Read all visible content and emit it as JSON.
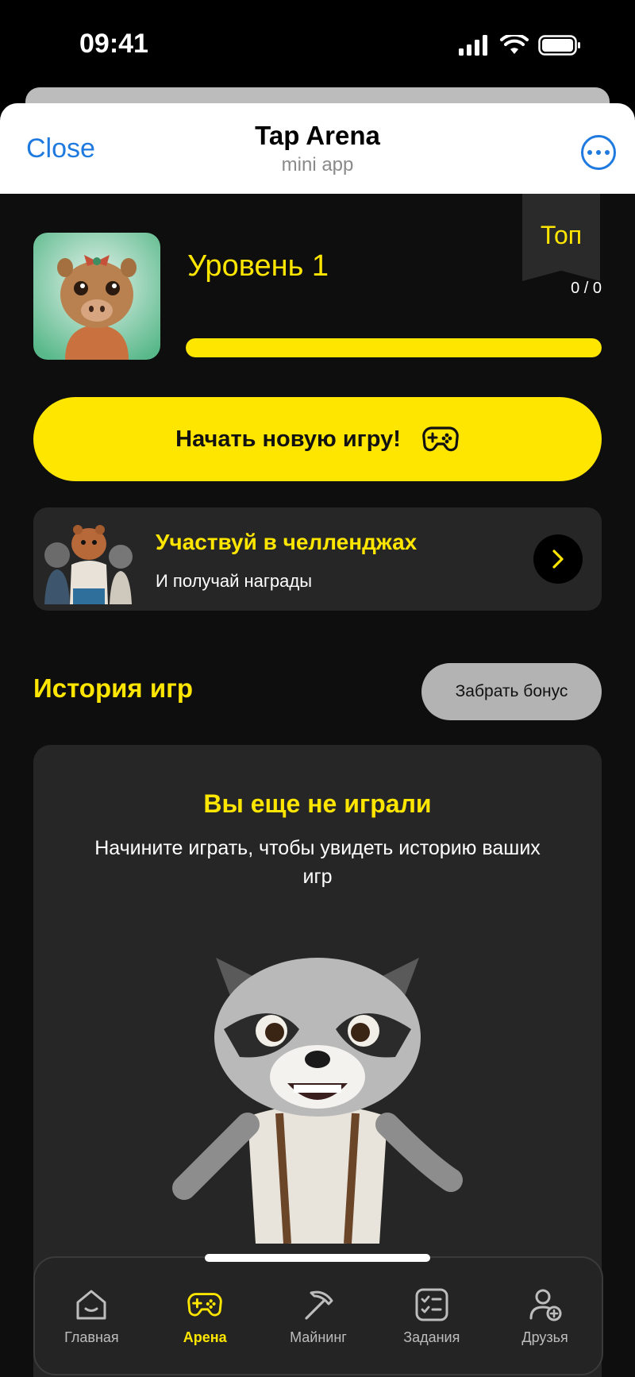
{
  "status_bar": {
    "time": "09:41"
  },
  "header": {
    "close_label": "Close",
    "title": "Tap Arena",
    "subtitle": "mini app"
  },
  "top_ribbon": {
    "label": "Топ"
  },
  "level": {
    "title": "Уровень 1",
    "progress_text": "0 / 0",
    "progress_fraction": 1.0
  },
  "new_game": {
    "label": "Начать новую игру!"
  },
  "challenges": {
    "title": "Участвуй в челленджах",
    "subtitle": "И получай награды"
  },
  "history": {
    "title": "История игр",
    "bonus_label": "Забрать бонус",
    "empty_title": "Вы еще не играли",
    "empty_text": "Начините играть, чтобы увидеть историю ваших игр"
  },
  "nav": {
    "items": [
      {
        "label": "Главная",
        "icon": "home-icon",
        "active": false
      },
      {
        "label": "Арена",
        "icon": "gamepad-icon",
        "active": true
      },
      {
        "label": "Майнинг",
        "icon": "pickaxe-icon",
        "active": false
      },
      {
        "label": "Задания",
        "icon": "checklist-icon",
        "active": false
      },
      {
        "label": "Друзья",
        "icon": "add-friend-icon",
        "active": false
      }
    ]
  },
  "colors": {
    "accent": "#ffe600",
    "background": "#0e0e0e",
    "card": "#262626",
    "link": "#1f7ae0"
  }
}
